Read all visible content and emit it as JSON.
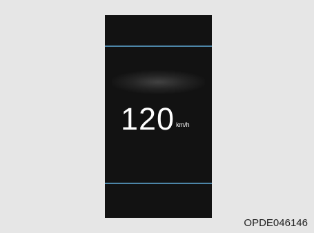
{
  "display": {
    "speed_value": "120",
    "speed_unit": "km/h"
  },
  "figure_code": "OPDE046146",
  "colors": {
    "background": "#e6e6e6",
    "panel": "#121212",
    "accent_line": "#4d86a8",
    "speed_text": "#ffffff"
  }
}
